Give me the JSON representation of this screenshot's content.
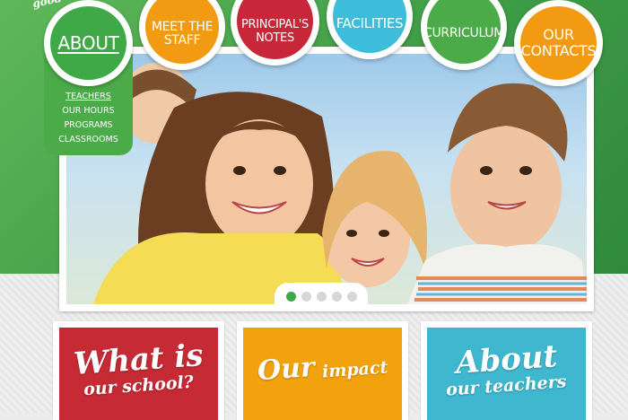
{
  "brand": {
    "logo_text": "good"
  },
  "nav": {
    "items": [
      {
        "label": "About",
        "color": "#3fa847"
      },
      {
        "label": "Meet the staff",
        "color": "#f29b12"
      },
      {
        "label": "Principal's notes",
        "color": "#c8273a"
      },
      {
        "label": "Facilities",
        "color": "#3ebddb"
      },
      {
        "label": "Curriculum",
        "color": "#4aab48"
      },
      {
        "label": "Our contacts",
        "color": "#f29b12"
      }
    ],
    "submenu": [
      "Teachers",
      "Our hours",
      "Programs",
      "Classrooms"
    ]
  },
  "hero": {
    "image_description_icon": "children-photo-icon",
    "slides_total": 5,
    "active_slide": 1
  },
  "cards": [
    {
      "line1": "What is",
      "line2": "our school?",
      "color": "#c52a35"
    },
    {
      "line1": "Our",
      "line2": "impact",
      "color": "#f2a20c"
    },
    {
      "line1": "About",
      "line2": "our teachers",
      "color": "#3eb7cf"
    }
  ]
}
